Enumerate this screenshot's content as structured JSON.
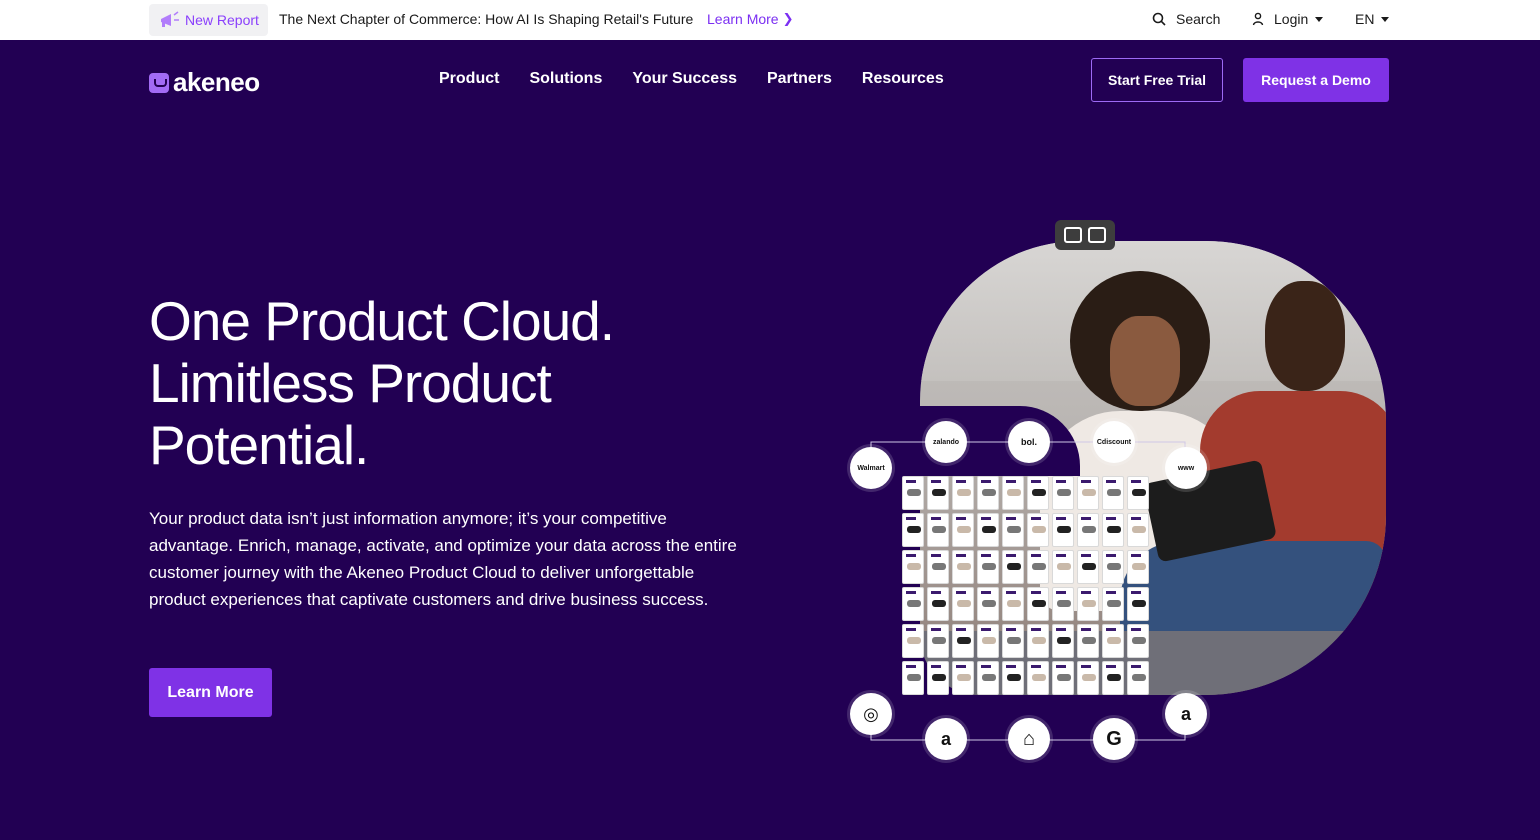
{
  "topbar": {
    "badge_label": "New Report",
    "announcement": "The Next Chapter of Commerce: How AI Is Shaping Retail's Future",
    "link_label": "Learn More",
    "search_label": "Search",
    "login_label": "Login",
    "language_label": "EN"
  },
  "nav": {
    "logo_text": "akeneo",
    "items": [
      "Product",
      "Solutions",
      "Your Success",
      "Partners",
      "Resources"
    ],
    "trial_label": "Start Free Trial",
    "demo_label": "Request a Demo"
  },
  "hero": {
    "title_lines": [
      "One Product Cloud.",
      "Limitless Product",
      "Potential."
    ],
    "body": "Your product data isn’t just information anymore; it’s your competitive advantage. Enrich, manage, activate, and optimize your data across the entire customer journey with the Akeneo Product Cloud to deliver unforgettable product experiences that captivate customers and drive business success.",
    "cta_label": "Learn More"
  },
  "graphic": {
    "top_nodes": [
      "Walmart",
      "zalando",
      "bol.",
      "Cdiscount",
      "www"
    ],
    "bottom_nodes": [
      "instagram-icon",
      "amazon-icon",
      "store-icon",
      "google-icon",
      "amazon-circle-icon"
    ],
    "bottom_glyphs": [
      "◎",
      "a",
      "⌂",
      "G",
      "a"
    ]
  },
  "colors": {
    "background": "#220053",
    "accent": "#7f32e6",
    "badge_text": "#8a3ffc",
    "link": "#7b2ff2"
  }
}
